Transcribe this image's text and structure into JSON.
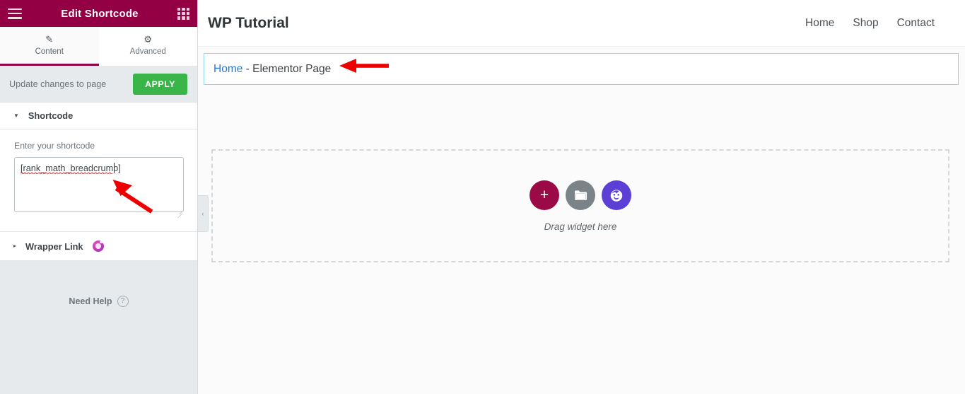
{
  "panel": {
    "header": {
      "title": "Edit Shortcode",
      "menu_icon": "hamburger-menu-icon",
      "widgets_icon": "widget-grid-icon"
    },
    "tabs": [
      {
        "label": "Content",
        "icon": "pencil-icon",
        "glyph": "✎",
        "active": true
      },
      {
        "label": "Advanced",
        "icon": "gear-icon",
        "glyph": "⚙",
        "active": false
      }
    ],
    "apply_bar": {
      "text": "Update changes to page",
      "button_label": "APPLY"
    },
    "sections": [
      {
        "title": "Shortcode",
        "expanded": true,
        "caret": "▼",
        "pro": false
      },
      {
        "title": "Wrapper Link",
        "expanded": false,
        "caret": "▸",
        "pro": true
      }
    ],
    "shortcode_control": {
      "label": "Enter your shortcode",
      "value": "[rank_math_breadcrumb]",
      "placeholder": ""
    },
    "need_help": {
      "label": "Need Help",
      "icon_glyph": "?"
    },
    "collapse_handle": {
      "glyph": "‹"
    }
  },
  "canvas": {
    "site_header": {
      "title": "WP Tutorial",
      "nav": [
        {
          "label": "Home"
        },
        {
          "label": "Shop"
        },
        {
          "label": "Contact"
        }
      ]
    },
    "breadcrumb_widget": {
      "link_label": "Home",
      "separator": " - ",
      "current": "Elementor Page"
    },
    "drop_zone": {
      "hint": "Drag widget here",
      "buttons": [
        {
          "name": "add-section-button",
          "glyph": "+",
          "color": "#9b0a46"
        },
        {
          "name": "add-folder-button",
          "glyph": "folder-icon",
          "color": "#7a8388"
        },
        {
          "name": "add-template-button",
          "glyph": "template-face-icon",
          "color": "#5b3fd6"
        }
      ]
    }
  },
  "annotations": [
    {
      "name": "arrow-pointing-to-breadcrumb",
      "direction": "left",
      "color": "#ee0000"
    },
    {
      "name": "arrow-pointing-to-shortcode-field",
      "direction": "up-left",
      "color": "#ee0000"
    }
  ],
  "colors": {
    "brand": "#930044",
    "apply_green": "#39b54a",
    "widget_outline": "#8fd3ef",
    "link_blue": "#2679d6",
    "annotation_red": "#ee0000"
  }
}
